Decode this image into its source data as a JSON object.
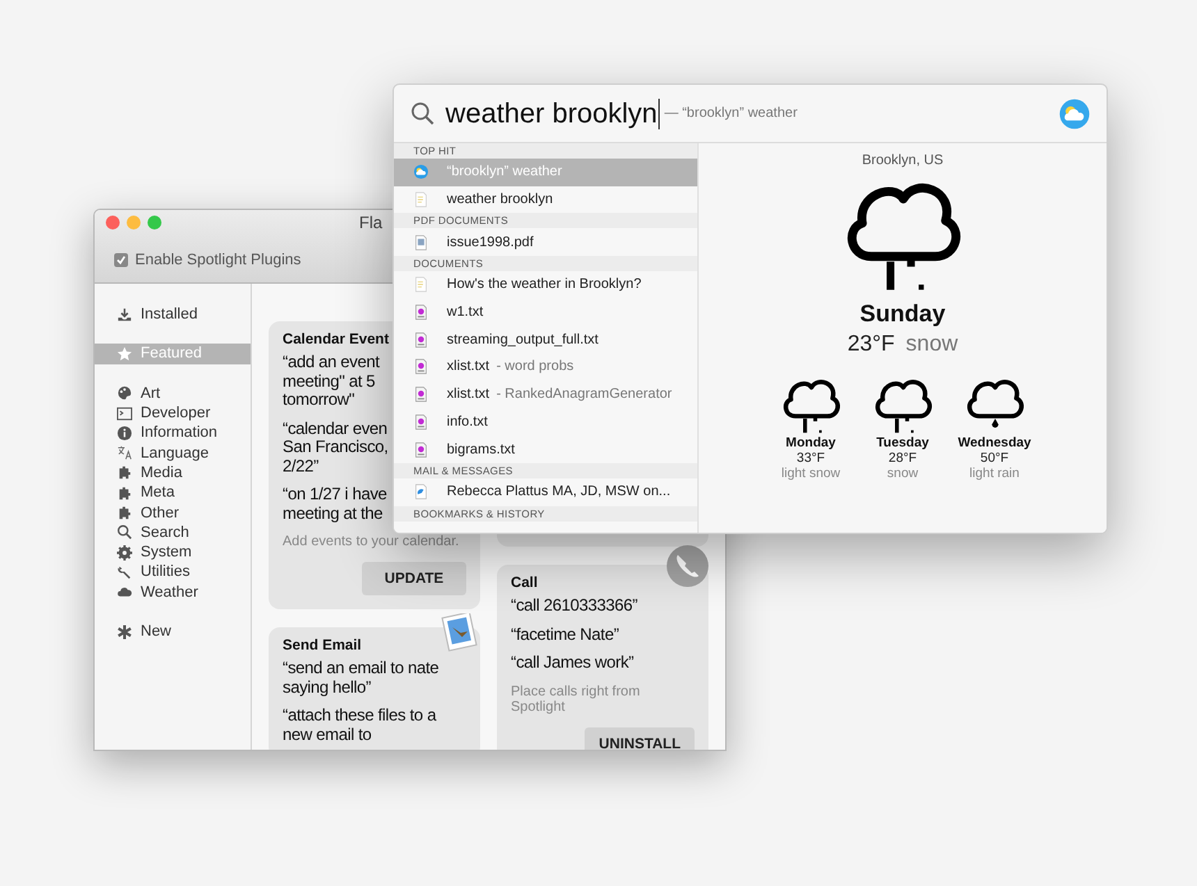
{
  "plugins_window": {
    "title": "Fla",
    "enable_plugins": {
      "label": "Enable Spotlight Plugins",
      "checked": true
    },
    "sidebar": {
      "sections": [
        [
          {
            "label": "Installed",
            "selected": false
          }
        ],
        [
          {
            "label": "Featured",
            "selected": true
          }
        ],
        [
          {
            "label": "Art",
            "selected": false
          },
          {
            "label": "Developer",
            "selected": false
          },
          {
            "label": "Information",
            "selected": false
          },
          {
            "label": "Language",
            "selected": false
          },
          {
            "label": "Media",
            "selected": false
          },
          {
            "label": "Meta",
            "selected": false
          },
          {
            "label": "Other",
            "selected": false
          },
          {
            "label": "Search",
            "selected": false
          },
          {
            "label": "System",
            "selected": false
          },
          {
            "label": "Utilities",
            "selected": false
          },
          {
            "label": "Weather",
            "selected": false
          }
        ],
        [
          {
            "label": "New",
            "selected": false
          }
        ]
      ]
    },
    "columns": [
      [
        {
          "title": "Calendar Event",
          "examples": [
            [
              "“add an event",
              "meeting\" at 5",
              "tomorrow\""
            ],
            [
              "“calendar even",
              "San Francisco,",
              "2/22”"
            ],
            [
              "“on 1/27 i have",
              "meeting at the"
            ]
          ],
          "hint": "Add events to your calendar.",
          "button": "UPDATE"
        },
        {
          "title": "Send Email",
          "examples": [
            [
              "“send an email to nate",
              "saying hello”"
            ],
            [
              "“attach these files to a",
              "new email to"
            ]
          ]
        }
      ],
      [
        {
          "title": "Call",
          "examples": [
            [
              "“call 2610333366”"
            ],
            [
              "“facetime Nate”"
            ],
            [
              "“call James work”"
            ]
          ],
          "hint": "Place calls right from Spotlight",
          "button": "UNINSTALL"
        }
      ]
    ]
  },
  "spotlight": {
    "query": "weather brooklyn",
    "completion": "— “brooklyn” weather",
    "sections": [
      {
        "title": "TOP HIT",
        "items": [
          {
            "name": "“brooklyn” weather",
            "kind": "weather",
            "selected": true
          },
          {
            "name": "weather brooklyn",
            "kind": "note",
            "selected": false
          }
        ]
      },
      {
        "title": "PDF DOCUMENTS",
        "items": [
          {
            "name": "issue1998.pdf",
            "kind": "pdf",
            "selected": false
          }
        ]
      },
      {
        "title": "DOCUMENTS",
        "items": [
          {
            "name": "How's the weather in Brooklyn?",
            "kind": "note",
            "selected": false
          },
          {
            "name": "w1.txt",
            "kind": "text",
            "selected": false
          },
          {
            "name": "streaming_output_full.txt",
            "kind": "text",
            "selected": false
          },
          {
            "name": "xlist.txt",
            "detail": "- word probs",
            "kind": "text",
            "selected": false
          },
          {
            "name": "xlist.txt",
            "detail": "- RankedAnagramGenerator",
            "kind": "text",
            "selected": false
          },
          {
            "name": "info.txt",
            "kind": "text",
            "selected": false
          },
          {
            "name": "bigrams.txt",
            "kind": "text",
            "selected": false
          }
        ]
      },
      {
        "title": "MAIL & MESSAGES",
        "items": [
          {
            "name": "Rebecca Plattus MA, JD, MSW on...",
            "kind": "mail",
            "selected": false
          }
        ]
      },
      {
        "title": "BOOKMARKS & HISTORY"
      }
    ],
    "weather": {
      "location": "Brooklyn, US",
      "day": "Sunday",
      "temp": "23°F",
      "condition": "snow",
      "forecast": [
        {
          "day": "Monday",
          "temp": "33°F",
          "condition": "light snow"
        },
        {
          "day": "Tuesday",
          "temp": "28°F",
          "condition": "snow"
        },
        {
          "day": "Wednesday",
          "temp": "50°F",
          "condition": "light rain"
        }
      ]
    }
  }
}
